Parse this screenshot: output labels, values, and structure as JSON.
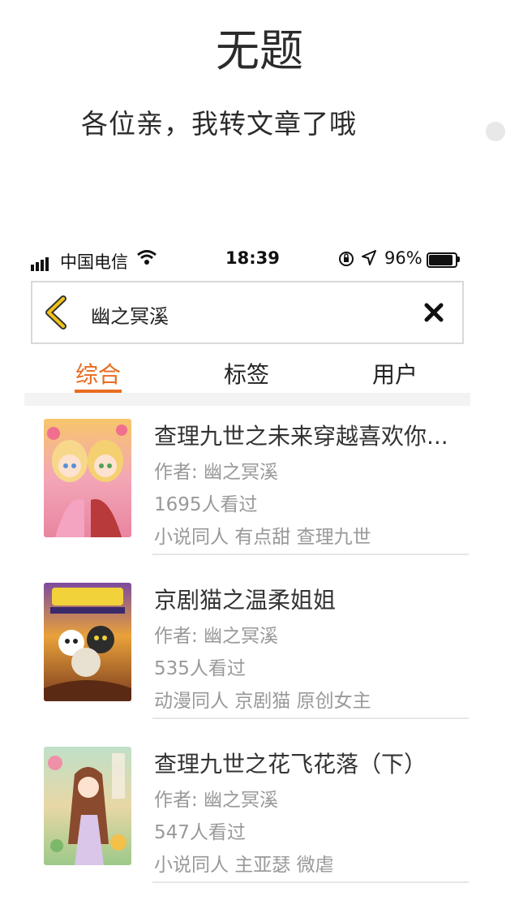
{
  "post": {
    "title": "无题",
    "subtitle": "各位亲，我转文章了哦"
  },
  "status_bar": {
    "carrier": "中国电信",
    "time": "18:39",
    "battery_pct": "96%",
    "battery_level": 0.96
  },
  "search": {
    "query": "幽之冥溪",
    "back_icon": "chevron-left-icon",
    "clear_icon": "close-icon"
  },
  "tabs": [
    {
      "label": "综合",
      "active": true
    },
    {
      "label": "标签",
      "active": false
    },
    {
      "label": "用户",
      "active": false
    }
  ],
  "colors": {
    "accent": "#e86c1f",
    "meta_text": "#999999"
  },
  "results": [
    {
      "title": "查理九世之未来穿越喜欢你...",
      "author": "作者: 幽之冥溪",
      "views": "1695人看过",
      "tags": "小说同人 有点甜 查理九世"
    },
    {
      "title": "京剧猫之温柔姐姐",
      "author": "作者: 幽之冥溪",
      "views": "535人看过",
      "tags": "动漫同人 京剧猫 原创女主"
    },
    {
      "title": "查理九世之花飞花落（下）",
      "author": "作者: 幽之冥溪",
      "views": "547人看过",
      "tags": "小说同人 主亚瑟 微虐"
    }
  ]
}
